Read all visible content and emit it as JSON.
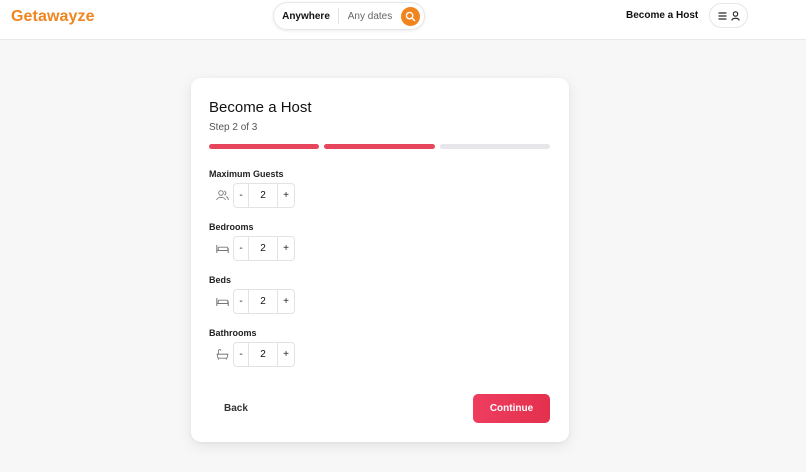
{
  "header": {
    "brand": "Getawayze",
    "search": {
      "where": "Anywhere",
      "dates": "Any dates"
    },
    "become_host": "Become a Host",
    "colors": {
      "brand": "#f0851f",
      "accent": "#e8465c"
    }
  },
  "wizard": {
    "title": "Become a Host",
    "step_text": "Step 2 of 3",
    "progress": {
      "current_step": 2,
      "total_steps": 3
    },
    "fields": [
      {
        "label": "Maximum Guests",
        "icon": "users-icon",
        "value": "2",
        "dec": "-",
        "inc": "+"
      },
      {
        "label": "Bedrooms",
        "icon": "bed-icon",
        "value": "2",
        "dec": "-",
        "inc": "+"
      },
      {
        "label": "Beds",
        "icon": "bed-icon",
        "value": "2",
        "dec": "-",
        "inc": "+"
      },
      {
        "label": "Bathrooms",
        "icon": "bathtub-icon",
        "value": "2",
        "dec": "-",
        "inc": "+"
      }
    ],
    "back_label": "Back",
    "continue_label": "Continue"
  }
}
